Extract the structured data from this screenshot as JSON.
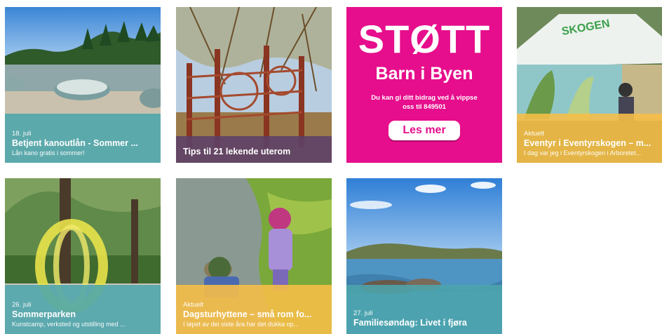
{
  "cards": [
    {
      "meta": "18. juli",
      "title": "Betjent kanoutlån - Sommer ...",
      "sub": "Lån kano gratis i sommer!"
    },
    {
      "title": "Tips til 21 lekende uterom"
    },
    {
      "support": {
        "big": "STØTT",
        "mid": "Barn i Byen",
        "small": "Du kan gi ditt bidrag ved å vippse oss til 849501",
        "button": "Les mer"
      }
    },
    {
      "meta": "Aktuelt",
      "title": "Eventyr i Eventyrskogen – m...",
      "sub": "I dag var jeg i Eventyrskogen i Arboretet..."
    },
    {
      "meta": "26. juli",
      "title": "Sommerparken",
      "sub": "Kunstcamp, verksted og utstilling med ..."
    },
    {
      "meta": "Aktuelt",
      "title": "Dagsturhyttene – små rom fo...",
      "sub": "I løpet av dei siste åra har det dukka op..."
    },
    {
      "meta": "27. juli",
      "title": "Familiesøndag: Livet i fjøra"
    }
  ],
  "colors": {
    "teal": "#4ca5ac",
    "yellow": "#f5be48",
    "purple": "#5c4068",
    "pink": "#e60e8c"
  }
}
